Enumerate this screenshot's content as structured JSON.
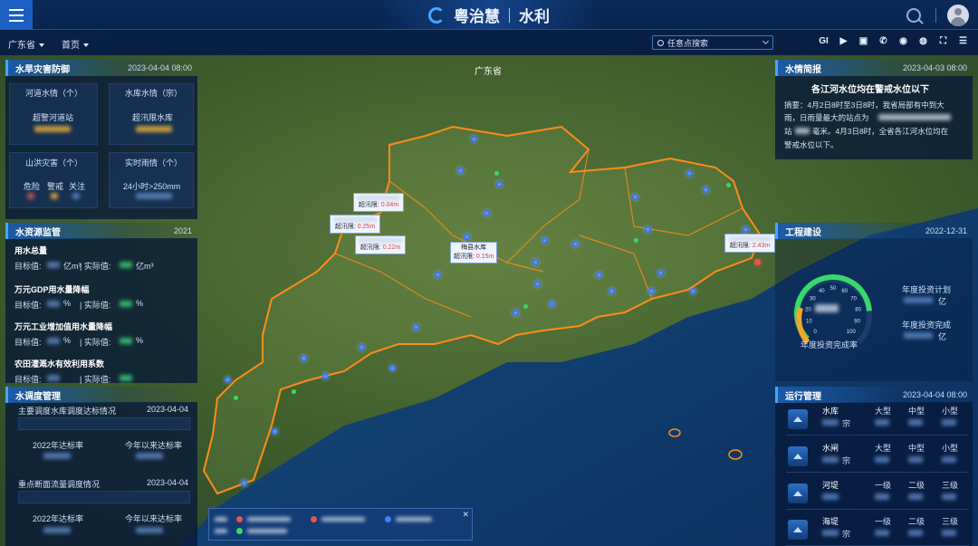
{
  "header": {
    "brand_name": "粤治慧",
    "module_name": "水利",
    "icons": [
      "menu-icon",
      "search-icon",
      "user-avatar-icon"
    ]
  },
  "subbar": {
    "province_select": "广东省",
    "page_select": "首页",
    "search_placeholder": "任意点搜索",
    "tool_gi": "GI"
  },
  "map": {
    "province_label": "广东省",
    "callouts": [
      {
        "prefix": "超汛限",
        "value": "0.04m"
      },
      {
        "prefix": "超汛限",
        "value": "0.25m"
      },
      {
        "prefix": "超汛限",
        "value": "0.22m"
      },
      {
        "prefix": "超汛限",
        "value": "0.15m"
      },
      {
        "prefix": "超汛限",
        "value": "2.43m"
      }
    ],
    "callout_station_names": [
      "梅县水库"
    ]
  },
  "left": {
    "flood": {
      "title": "水旱灾害防御",
      "date": "2023-04-04 08:00",
      "river_label": "河道水情（个）",
      "river_sub": "超警河道站",
      "reservoir_label": "水库水情（宗）",
      "reservoir_sub": "超汛限水库",
      "mountain_label": "山洪灾害（个）",
      "mountain_items": [
        "危险",
        "警戒",
        "关注"
      ],
      "rain_label": "实时雨情（个）",
      "rain_sub": "24小时>250mm"
    },
    "water_resource": {
      "title": "水资源监管",
      "year": "2021",
      "items": [
        {
          "name": "用水总量",
          "target": "目标值:",
          "unit1": "亿m³",
          "sep": "| 实际值:",
          "unit2": "亿m³"
        },
        {
          "name": "万元GDP用水量降幅",
          "target": "目标值:",
          "unit1": "%",
          "sep": "| 实际值:",
          "unit2": "%"
        },
        {
          "name": "万元工业增加值用水量降幅",
          "target": "目标值:",
          "unit1": "%",
          "sep": "| 实际值:",
          "unit2": "%"
        },
        {
          "name": "农田灌溉水有效利用系数",
          "target": "目标值:",
          "unit1": "",
          "sep": "| 实际值:",
          "unit2": ""
        }
      ]
    },
    "dispatch": {
      "title": "水调度管理",
      "sub1_title": "主要调度水库调度达标情况",
      "sub1_date": "2023-04-04",
      "sub1_labels": [
        "2022年达标率",
        "今年以来达标率"
      ],
      "sub2_title": "重点断面流量调度情况",
      "sub2_date": "2023-04-04",
      "sub2_labels": [
        "2022年达标率",
        "今年以来达标率"
      ]
    }
  },
  "right": {
    "brief": {
      "title": "水情简报",
      "date": "2023-04-03 08:00",
      "headline": "各江河水位均在警戒水位以下",
      "body_line1": "摘要：4月2日8时至3日8时，我省局部有中到大",
      "body_line2": "雨，日雨量最大的站点为",
      "body_line3": "站",
      "body_line3b": "毫米。4月3日8时，全省各江河水位均在",
      "body_line4": "警戒水位以下。"
    },
    "project": {
      "title": "工程建设",
      "date": "2022-12-31",
      "gauge_ticks": [
        "0",
        "10",
        "20",
        "30",
        "40",
        "50",
        "60",
        "70",
        "80",
        "90",
        "100"
      ],
      "gauge_label": "年度投资完成率",
      "gauge_value": 0.82,
      "plan_label": "年度投资计划",
      "plan_unit": "亿",
      "done_label": "年度投资完成",
      "done_unit": "亿"
    },
    "operation": {
      "title": "运行管理",
      "date": "2023-04-04 08:00",
      "rows": [
        {
          "name": "水库",
          "cols": [
            "大型",
            "中型",
            "小型"
          ],
          "unit": "宗"
        },
        {
          "name": "水闸",
          "cols": [
            "大型",
            "中型",
            "小型"
          ],
          "unit": "宗"
        },
        {
          "name": "河堤",
          "cols": [
            "一级",
            "二级",
            "三级"
          ],
          "unit": ""
        },
        {
          "name": "海堤",
          "cols": [
            "一级",
            "二级",
            "三级"
          ],
          "unit": "宗"
        }
      ]
    }
  },
  "colors": {
    "accent": "#49a3ff",
    "boundary": "#ff8c1a",
    "green_value": "#39d86b",
    "alert_red": "#e03b3b"
  }
}
